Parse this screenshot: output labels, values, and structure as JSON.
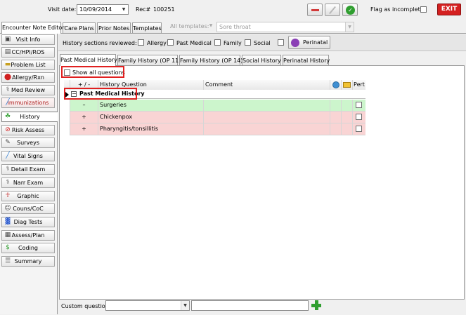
{
  "topbar": {
    "visit_date_label": "Visit date:",
    "visit_date_value": "10/09/2014",
    "rec_label": "Rec#",
    "rec_value": "100251",
    "flag_label": "Flag as incomplete",
    "exit_label": "EXIT"
  },
  "main_tabs": [
    "Encounter Note Editor",
    "Care Plans",
    "Prior Notes",
    "Templates"
  ],
  "templates": {
    "label": "All templates:",
    "value": "Sore throat"
  },
  "sidebar": {
    "items": [
      {
        "label": "Visit Info",
        "icon": "visit-info-icon"
      },
      {
        "label": "CC/HPI/ROS",
        "icon": "cc-hpi-ros-icon"
      },
      {
        "label": "Problem List",
        "icon": "problem-list-icon"
      },
      {
        "label": "Allergy/Rxn",
        "icon": "allergy-icon"
      },
      {
        "label": "Med Review",
        "icon": "med-review-icon"
      },
      {
        "label": "Immunizations",
        "icon": "syringe-icon"
      },
      {
        "label": "History",
        "icon": "history-icon"
      },
      {
        "label": "Risk Assess",
        "icon": "no-smoking-icon"
      },
      {
        "label": "Surveys",
        "icon": "survey-icon"
      },
      {
        "label": "Vital Signs",
        "icon": "vital-signs-icon"
      },
      {
        "label": "Detail Exam",
        "icon": "stethoscope-icon"
      },
      {
        "label": "Narr Exam",
        "icon": "stethoscope-icon"
      },
      {
        "label": "Graphic",
        "icon": "body-icon"
      },
      {
        "label": "Couns/CoC",
        "icon": "counseling-icon"
      },
      {
        "label": "Diag Tests",
        "icon": "diag-tests-icon"
      },
      {
        "label": "Assess/Plan",
        "icon": "assess-plan-icon"
      },
      {
        "label": "Coding",
        "icon": "dollar-icon"
      },
      {
        "label": "Summary",
        "icon": "summary-icon"
      }
    ]
  },
  "history_sections": {
    "label": "History sections reviewed:",
    "items": [
      "Allergy",
      "Past Medical",
      "Family",
      "Social"
    ],
    "perinatal_label": "Perinatal"
  },
  "history_tabs": [
    "Past Medical History",
    "Family History (OP 11)",
    "Family History (OP 14)",
    "Social History",
    "Perinatal History"
  ],
  "show_all_label": "Show all questions",
  "grid": {
    "columns": [
      "+ / -",
      "History Question",
      "Comment",
      "Pert"
    ],
    "group_label": "Past Medical History",
    "rows": [
      {
        "sign": "–",
        "question": "Surgeries",
        "comment": "",
        "color": "#ccf5cc"
      },
      {
        "sign": "+",
        "question": "Chickenpox",
        "comment": "",
        "color": "#f9d4d4"
      },
      {
        "sign": "+",
        "question": "Pharyngitis/tonsillitis",
        "comment": "",
        "color": "#f9d4d4"
      }
    ]
  },
  "custom_question": {
    "label": "Custom question:",
    "value": "",
    "text": ""
  },
  "colors": {
    "accent_red": "#e02020",
    "exit_red": "#d42020",
    "positive_row": "#f9d4d4",
    "negative_row": "#ccf5cc"
  }
}
